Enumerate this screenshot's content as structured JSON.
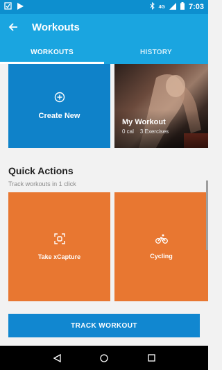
{
  "status_bar": {
    "time": "7:03",
    "network": "4G"
  },
  "app_bar": {
    "title": "Workouts"
  },
  "tabs": [
    {
      "label": "WORKOUTS",
      "active": true
    },
    {
      "label": "HISTORY",
      "active": false
    }
  ],
  "create_card": {
    "label": "Create New"
  },
  "workout_card": {
    "name": "My Workout",
    "calories": "0 cal",
    "exercises": "3 Exercises"
  },
  "quick_actions": {
    "title": "Quick Actions",
    "subtitle": "Track workouts in 1 click",
    "items": [
      {
        "label": "Take xCapture",
        "icon": "capture-icon"
      },
      {
        "label": "Cycling",
        "icon": "cycling-icon"
      }
    ]
  },
  "track_button": {
    "label": "TRACK WORKOUT"
  },
  "colors": {
    "app_bar": "#1aa5e0",
    "status_bar": "#0d8fcf",
    "primary_card": "#0f82c9",
    "action_card": "#e87731",
    "button": "#1187d0"
  }
}
